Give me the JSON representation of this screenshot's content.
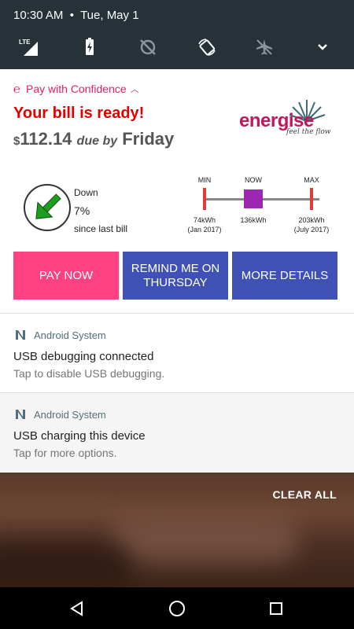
{
  "status_bar": {
    "time": "10:30 AM",
    "date": "Tue, May 1"
  },
  "quick_settings": {
    "icons": [
      "lte-signal-icon",
      "battery-charging-icon",
      "data-saver-off-icon",
      "auto-rotate-icon",
      "airplane-mode-icon",
      "expand-icon"
    ],
    "lte_label": "LTE"
  },
  "energise": {
    "app_name": "Pay with Confidence",
    "title": "Your bill is ready!",
    "currency": "$",
    "amount": "112.14",
    "due_text": "due by",
    "due_day": "Friday",
    "logo_word": "energise",
    "logo_tagline": "feel the flow",
    "trend": {
      "direction": "Down",
      "percent": "7%",
      "since": "since last bill",
      "arrow_color": "#1e9e1e"
    },
    "range": {
      "min_label": "MIN",
      "now_label": "NOW",
      "max_label": "MAX",
      "min_value": "74kWh",
      "min_date": "(Jan 2017)",
      "now_value": "136kWh",
      "max_value": "203kWh",
      "max_date": "(July 2017)"
    },
    "buttons": {
      "pay": "PAY NOW",
      "remind": "REMIND ME ON THURSDAY",
      "more": "MORE DETAILS"
    }
  },
  "notifications": [
    {
      "app": "Android System",
      "title": "USB debugging connected",
      "text": "Tap to disable USB debugging."
    },
    {
      "app": "Android System",
      "title": "USB charging this device",
      "text": "Tap for more options."
    }
  ],
  "clear_all": "CLEAR ALL",
  "colors": {
    "pink": "#ff4081",
    "indigo": "#3f51b5",
    "red": "#e50000",
    "header": "#263238"
  }
}
